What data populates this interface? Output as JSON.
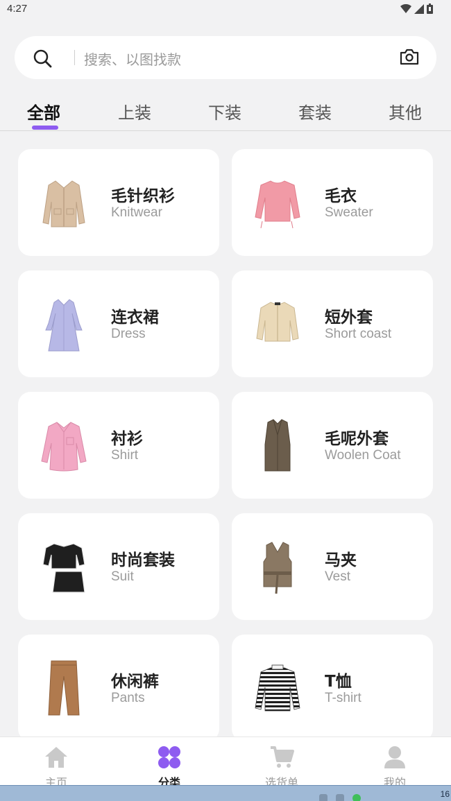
{
  "status_bar": {
    "time": "4:27"
  },
  "search": {
    "placeholder": "搜索、以图找款"
  },
  "tabs": [
    {
      "label": "全部",
      "active": true
    },
    {
      "label": "上装",
      "active": false
    },
    {
      "label": "下装",
      "active": false
    },
    {
      "label": "套装",
      "active": false
    },
    {
      "label": "其他",
      "active": false
    }
  ],
  "categories": [
    {
      "zh": "毛针织衫",
      "en": "Knitwear",
      "icon": "cardigan-icon"
    },
    {
      "zh": "毛衣",
      "en": "Sweater",
      "icon": "sweater-icon"
    },
    {
      "zh": "连衣裙",
      "en": "Dress",
      "icon": "dress-icon"
    },
    {
      "zh": "短外套",
      "en": "Short coast",
      "icon": "short-jacket-icon"
    },
    {
      "zh": "衬衫",
      "en": "Shirt",
      "icon": "shirt-icon"
    },
    {
      "zh": "毛呢外套",
      "en": "Woolen Coat",
      "icon": "woolen-coat-icon"
    },
    {
      "zh": "时尚套装",
      "en": "Suit",
      "icon": "suit-icon"
    },
    {
      "zh": "马夹",
      "en": "Vest",
      "icon": "vest-icon"
    },
    {
      "zh": "休闲裤",
      "en": "Pants",
      "icon": "pants-icon"
    },
    {
      "zh": "T恤",
      "en": "T-shirt",
      "icon": "tshirt-icon"
    }
  ],
  "bottom_nav": [
    {
      "label": "主页",
      "icon": "home-icon",
      "active": false
    },
    {
      "label": "分类",
      "icon": "category-icon",
      "active": true
    },
    {
      "label": "选货单",
      "icon": "cart-icon",
      "active": false
    },
    {
      "label": "我的",
      "icon": "profile-icon",
      "active": false
    }
  ],
  "taskbar": {
    "clock": "16"
  },
  "colors": {
    "accent": "#8e5cf0",
    "background": "#f2f2f3",
    "card": "#ffffff"
  }
}
